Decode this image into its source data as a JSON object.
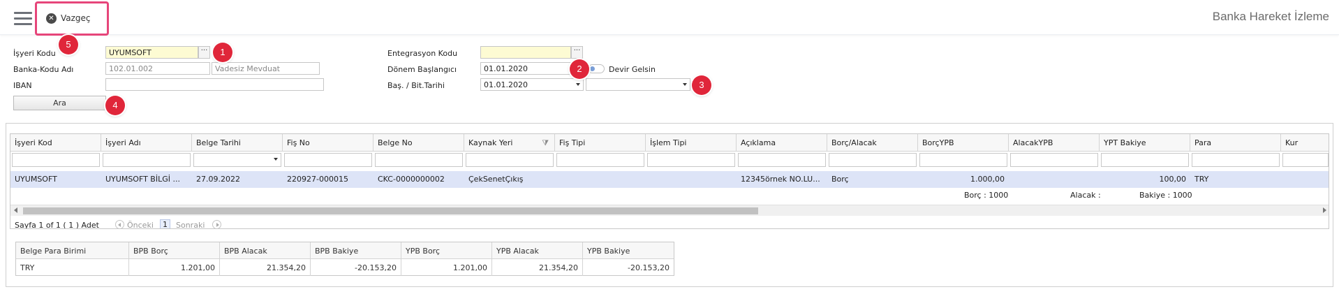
{
  "topbar": {
    "cancel_label": "Vazgeç",
    "page_title": "Banka Hareket İzleme"
  },
  "badges": [
    "1",
    "2",
    "3",
    "4",
    "5"
  ],
  "form": {
    "isyeri_kodu_label": "İşyeri Kodu",
    "isyeri_kodu_value": "UYUMSOFT",
    "banka_kodu_label": "Banka-Kodu Adı",
    "banka_kodu_value": "102.01.002",
    "banka_adi_value": "Vadesiz Mevduat",
    "iban_label": "IBAN",
    "iban_value": "",
    "ara_label": "Ara",
    "entegrasyon_label": "Entegrasyon Kodu",
    "entegrasyon_value": "",
    "donem_label": "Dönem Başlangıcı",
    "donem_value": "01.01.2020",
    "devir_label": "Devir Gelsin",
    "tarih_label": "Baş. / Bit.Tarihi",
    "bas_tarih_value": "01.01.2020",
    "bit_tarih_value": ""
  },
  "grid": {
    "columns": [
      "İşyeri Kod",
      "İşyeri Adı",
      "Belge Tarihi",
      "Fiş No",
      "Belge No",
      "Kaynak Yeri",
      "Fiş Tipi",
      "İşlem Tipi",
      "Açıklama",
      "Borç/Alacak",
      "BorçYPB",
      "AlacakYPB",
      "YPT Bakiye",
      "Para",
      "Kur"
    ],
    "row": {
      "isyeri_kod": "UYUMSOFT",
      "isyeri_adi": "UYUMSOFT BİLGİ ...",
      "belge_tarihi": "27.09.2022",
      "fis_no": "220927-000015",
      "belge_no": "CKC-0000000002",
      "kaynak_yeri": "ÇekSenetÇıkış",
      "fis_tipi": "",
      "islem_tipi": "",
      "aciklama": "12345örnek NO.LU...",
      "borc_alacak": "Borç",
      "borc_ypb": "1.000,00",
      "alacak_ypb": "",
      "ypt_bakiye": "100,00",
      "para": "TRY",
      "kur": ""
    },
    "summary": {
      "borc": "Borç : 1000",
      "alacak": "Alacak :",
      "bakiye": "Bakiye : 1000"
    }
  },
  "pager": {
    "info": "Sayfa 1 of 1 ( 1 ) Adet",
    "prev": "Önceki",
    "page": "1",
    "next": "Sonraki"
  },
  "summary_grid": {
    "columns": [
      "Belge Para Birimi",
      "BPB Borç",
      "BPB Alacak",
      "BPB Bakiye",
      "YPB Borç",
      "YPB Alacak",
      "YPB Bakiye"
    ],
    "row": [
      "TRY",
      "1.201,00",
      "21.354,20",
      "-20.153,20",
      "1.201,00",
      "21.354,20",
      "-20.153,20"
    ]
  }
}
